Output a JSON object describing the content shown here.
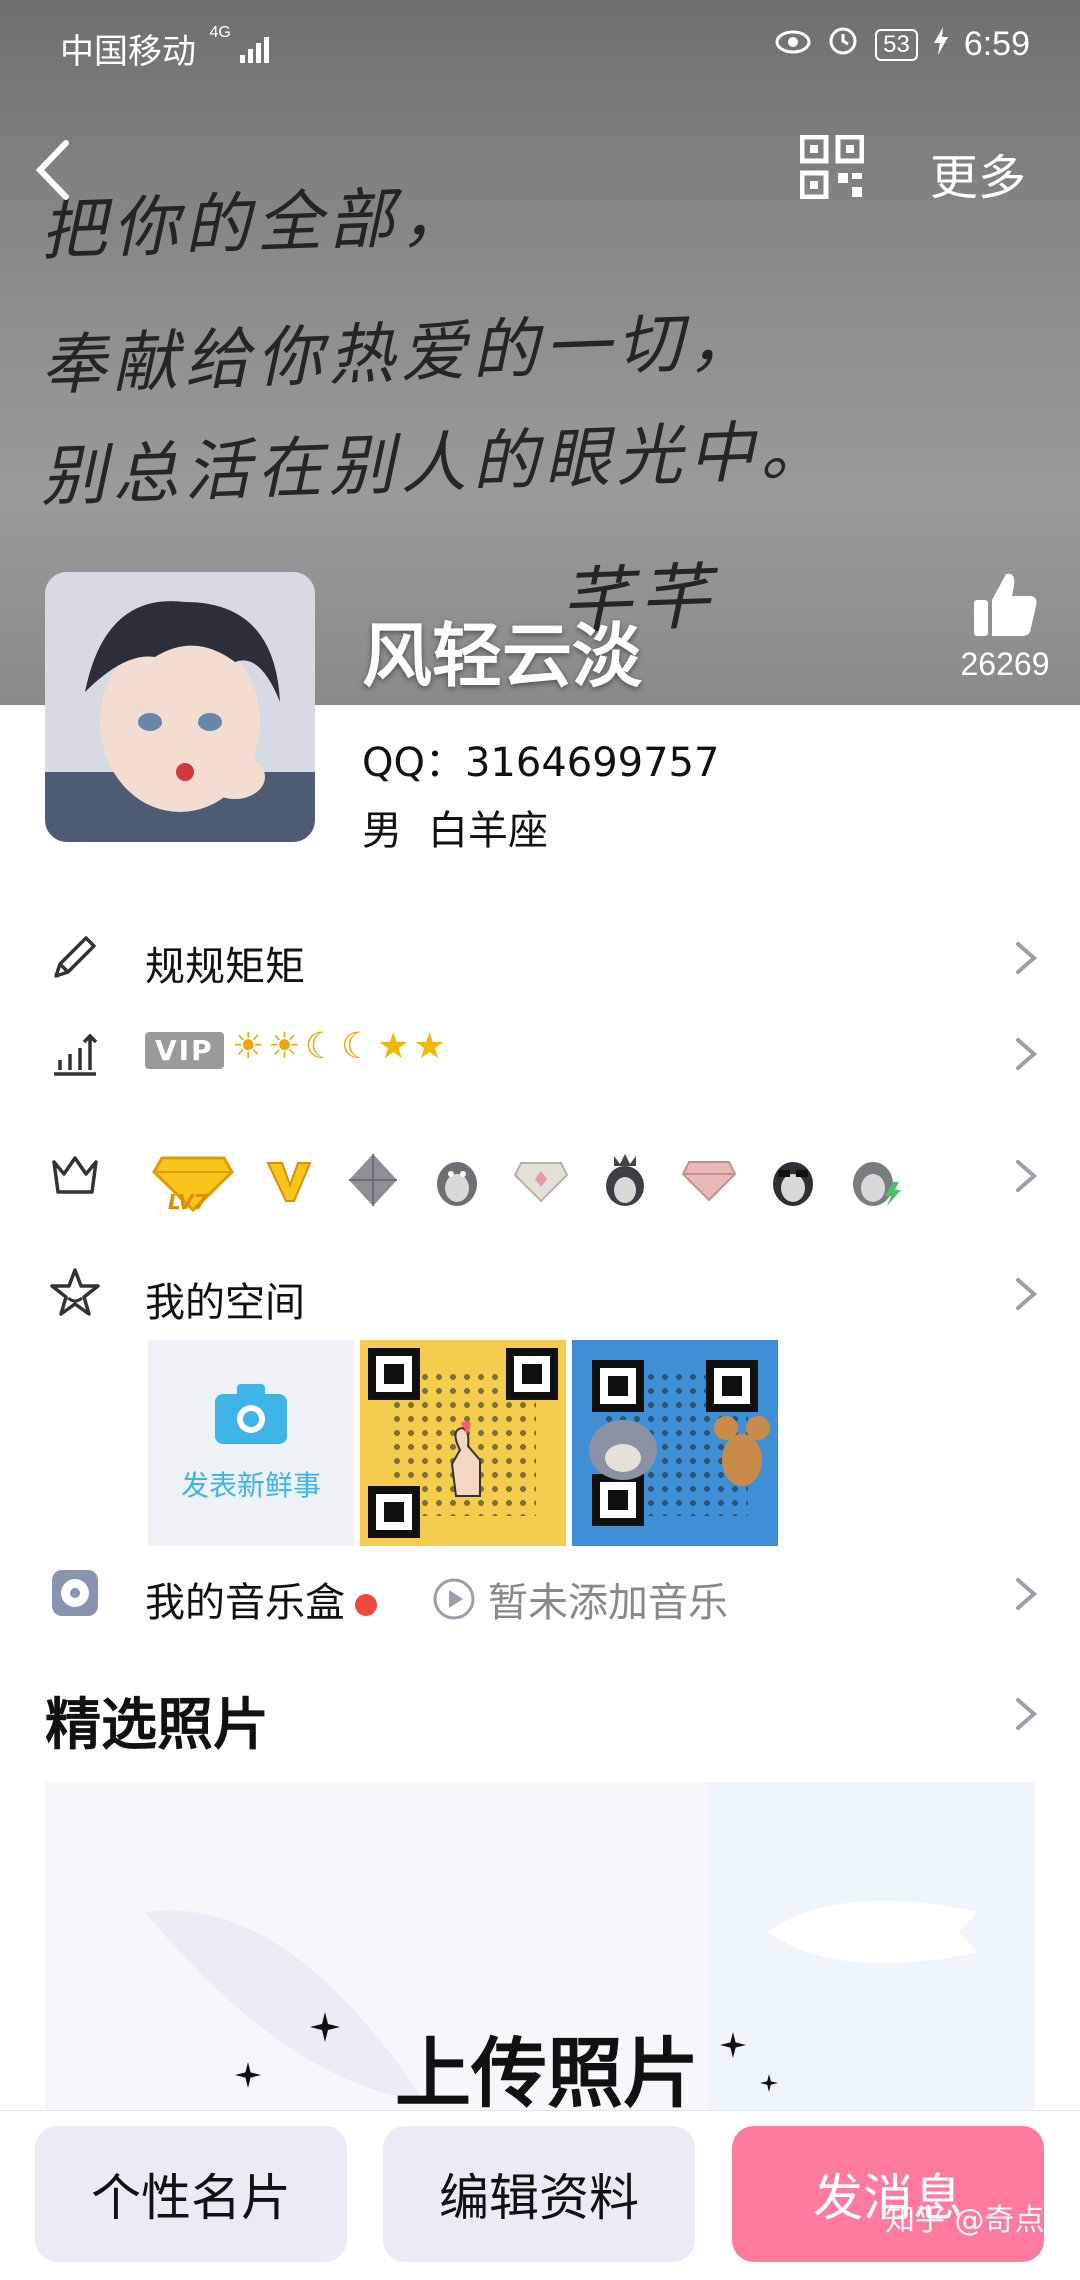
{
  "status_bar": {
    "carrier": "中国移动",
    "network": "4G",
    "battery": "53",
    "time": "6:59"
  },
  "cover": {
    "handwriting_lines": [
      "把你的全部，",
      "奉献给你热爱的一切，",
      "别总活在别人的眼光中。"
    ],
    "signature": "芊芊"
  },
  "header": {
    "more_label": "更多"
  },
  "profile": {
    "nickname": "风轻云淡",
    "likes": "26269",
    "qq_line": "QQ：3164699757",
    "gender": "男",
    "zodiac": "白羊座"
  },
  "rows": {
    "signature": "规规矩矩",
    "vip_tag": "VIP",
    "level_icons": [
      "sun",
      "sun",
      "moon",
      "moon",
      "star",
      "star"
    ],
    "badges": [
      "yellow-diamond-lv7",
      "v1-badge",
      "grey-crystal",
      "grey-penguin",
      "pink-diamond-grey",
      "crown-penguin",
      "pink-diamond",
      "sunglasses-penguin",
      "lightning-penguin"
    ],
    "badge_lv7_label": "LV7",
    "space": "我的空间",
    "space_post_label": "发表新鲜事",
    "music": "我的音乐盒",
    "music_empty": "暂未添加音乐"
  },
  "photos": {
    "title": "精选照片",
    "upload": "上传照片"
  },
  "bottom_bar": {
    "card": "个性名片",
    "edit": "编辑资料",
    "message": "发消息"
  },
  "watermark": "知乎 @奇点",
  "colors": {
    "accent_blue": "#3fb4e8",
    "send_pink": "#ff7b9d",
    "red_dot": "#f04a3e"
  }
}
